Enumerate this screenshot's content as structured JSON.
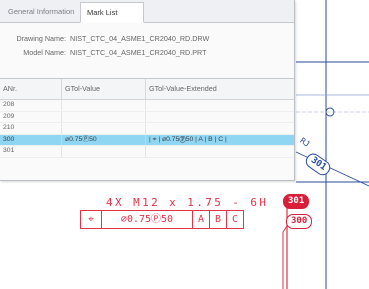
{
  "panel": {
    "tabs": [
      {
        "label": "General Information",
        "active": false
      },
      {
        "label": "Mark List",
        "active": true
      }
    ],
    "drawing_label": "Drawing Name:",
    "drawing_value": "NIST_CTC_04_ASME1_CR2040_RD.DRW",
    "model_label": "Model Name:",
    "model_value": "NIST_CTC_04_ASME1_CR2040_RD.PRT",
    "columns": [
      "ANr.",
      "GTol-Value",
      "GTol-Value-Extended"
    ],
    "rows": [
      {
        "anr": "208",
        "value": "",
        "extended": "",
        "selected": false
      },
      {
        "anr": "209",
        "value": "",
        "extended": "",
        "selected": false
      },
      {
        "anr": "210",
        "value": "",
        "extended": "",
        "selected": false
      },
      {
        "anr": "300",
        "value": "⌀0.75Ⓟ50",
        "extended": "| ⌖ | ⌀0.75Ⓟ50 | A | B | C |",
        "selected": true
      },
      {
        "anr": "301",
        "value": "",
        "extended": "",
        "selected": false
      }
    ],
    "colors": {
      "selection": "#8fd6f3"
    }
  },
  "cad": {
    "thread_callout": "4X M12 x 1.75 - 6H",
    "fcf": {
      "symbol_icon": "position-icon",
      "symbol": "⌖",
      "tolerance": "⌀0.75Ⓟ50",
      "datums": [
        "A",
        "B",
        "C"
      ]
    },
    "badges": [
      {
        "label": "301",
        "style": "solid"
      },
      {
        "label": "300",
        "style": "outline"
      }
    ],
    "side_label": "RJ",
    "side_badge": "301",
    "colors": {
      "pmi": "#e2334a",
      "geometry": "#2a4b9a"
    }
  }
}
